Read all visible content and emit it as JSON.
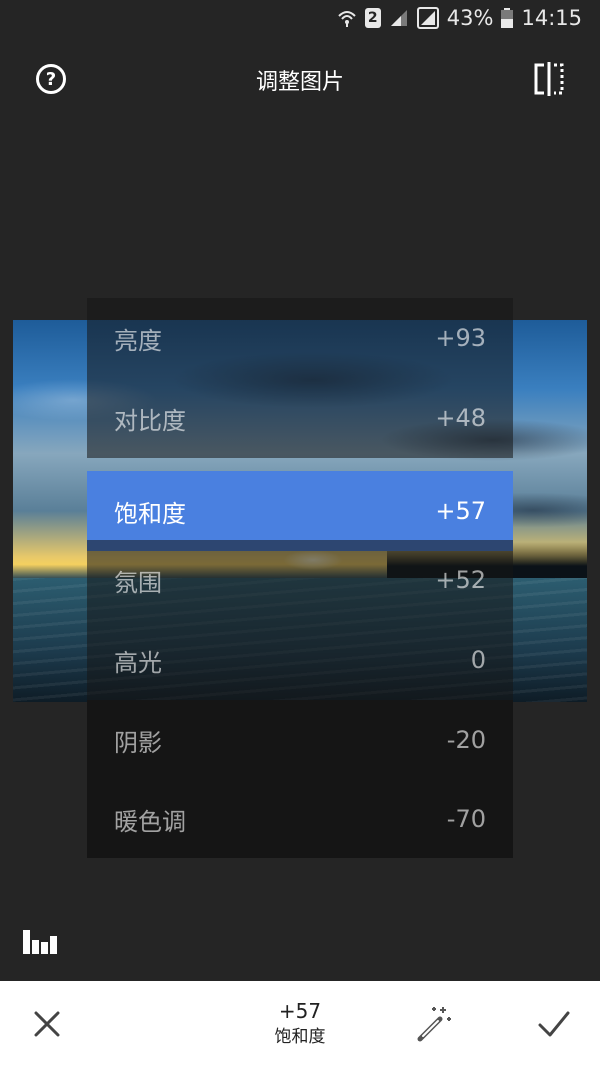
{
  "status_bar": {
    "sim_number": "2",
    "battery": "43%",
    "time": "14:15"
  },
  "header": {
    "title": "调整图片"
  },
  "adjustments": [
    {
      "label": "亮度",
      "value": "+93"
    },
    {
      "label": "对比度",
      "value": "+48"
    },
    {
      "label": "饱和度",
      "value": "+57"
    },
    {
      "label": "氛围",
      "value": "+52"
    },
    {
      "label": "高光",
      "value": "0"
    },
    {
      "label": "阴影",
      "value": "-20"
    },
    {
      "label": "暖色调",
      "value": "-70"
    }
  ],
  "selected_index": 2,
  "bottom_bar": {
    "value": "+57",
    "label": "饱和度"
  },
  "colors": {
    "background": "#252525",
    "selected_row": "#4a80e0"
  },
  "icons": {
    "help": "help-icon",
    "compare": "compare-icon",
    "histogram": "histogram-icon",
    "close": "close-icon",
    "auto": "magic-wand-icon",
    "apply": "check-icon"
  }
}
